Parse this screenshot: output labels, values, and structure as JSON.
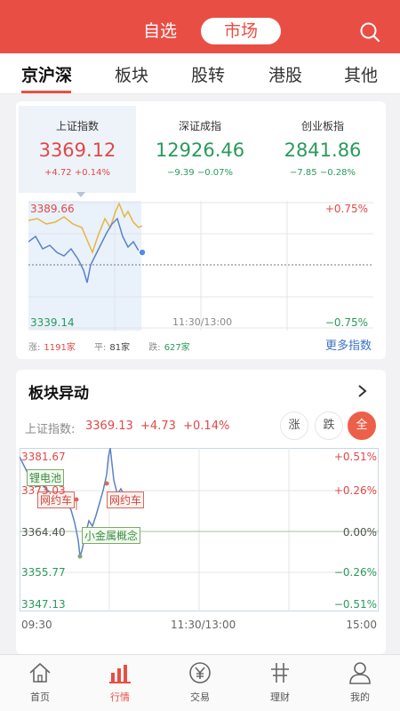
{
  "header": {
    "segments": [
      "自选",
      "市场"
    ],
    "active_segment": 1
  },
  "tabs": [
    "京沪深",
    "板块",
    "股转",
    "港股",
    "其他"
  ],
  "indices": [
    {
      "name": "上证指数",
      "value": "3369.12",
      "change": "+4.72",
      "pct": "+0.14%",
      "dir": "up"
    },
    {
      "name": "深证成指",
      "value": "12926.46",
      "change": "−9.39",
      "pct": "−0.07%",
      "dir": "down"
    },
    {
      "name": "创业板指",
      "value": "2841.86",
      "change": "−7.85",
      "pct": "−0.28%",
      "dir": "down"
    }
  ],
  "mini_chart": {
    "high": "3389.66",
    "low": "3339.14",
    "high_pct": "+0.75%",
    "low_pct": "−0.75%",
    "mid_time": "11:30/13:00"
  },
  "stats": {
    "up_label": "涨:",
    "up": "1191家",
    "flat_label": "平:",
    "flat": "81家",
    "down_label": "跌:",
    "down": "627家"
  },
  "more_indices": "更多指数",
  "sector": {
    "title": "板块异动",
    "index_label": "上证指数:",
    "index_value": "3369.13",
    "index_change": "+4.73",
    "index_pct": "+0.14%",
    "filters": [
      "涨",
      "跌",
      "全"
    ],
    "active_filter": 2,
    "y_left": [
      "3381.67",
      "3373.03",
      "3364.40",
      "3355.77",
      "3347.13"
    ],
    "y_right": [
      "+0.51%",
      "+0.26%",
      "0.00%",
      "−0.26%",
      "−0.51%"
    ],
    "x_labels": [
      "09:30",
      "11:30/13:00",
      "15:00"
    ],
    "tags": [
      "锂电池",
      "网约车",
      "网约车",
      "小金属概念"
    ]
  },
  "bottom_nav": [
    {
      "label": "首页",
      "icon": "home-icon"
    },
    {
      "label": "行情",
      "icon": "market-chart-icon"
    },
    {
      "label": "交易",
      "icon": "yuan-trade-icon"
    },
    {
      "label": "理财",
      "icon": "wealth-icon"
    },
    {
      "label": "我的",
      "icon": "user-icon"
    }
  ],
  "colors": {
    "brand": "#e94e44",
    "up": "#e04848",
    "down": "#2a9a5c",
    "link": "#3e72c4"
  }
}
